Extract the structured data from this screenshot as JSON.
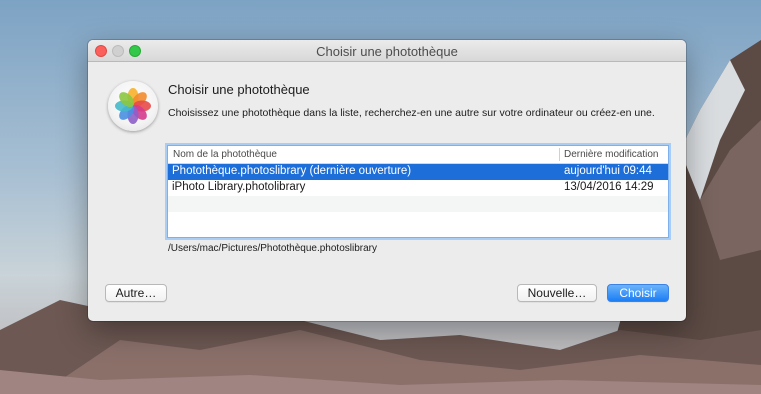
{
  "window": {
    "title": "Choisir une photothèque"
  },
  "dialog": {
    "heading": "Choisir une photothèque",
    "description": "Choisissez une photothèque dans la liste, recherchez-en une autre sur votre ordinateur ou créez-en une.",
    "icon": "photos-app-icon"
  },
  "table": {
    "columns": [
      "Nom de la photothèque",
      "Dernière modification"
    ],
    "rows": [
      {
        "name": "Photothèque.photoslibrary (dernière ouverture)",
        "modified": "aujourd'hui 09:44",
        "selected": true
      },
      {
        "name": "iPhoto Library.photolibrary",
        "modified": "13/04/2016 14:29",
        "selected": false
      }
    ]
  },
  "path": "/Users/mac/Pictures/Photothèque.photoslibrary",
  "buttons": {
    "other": "Autre…",
    "new": "Nouvelle…",
    "choose": "Choisir"
  },
  "colors": {
    "selection": "#1d6ed8",
    "default_button": "#1b7ef5",
    "close": "#fc605c",
    "maximize": "#34c84a"
  }
}
